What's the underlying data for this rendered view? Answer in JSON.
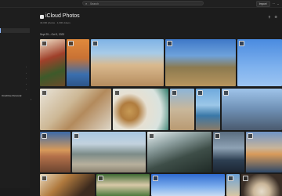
{
  "titlebar": {
    "search_placeholder": "Search",
    "import_label": "Import",
    "menu_label": "···"
  },
  "sidebar": {
    "items": [
      {
        "label": ""
      },
      {
        "label": ""
      },
      {
        "label": ""
      },
      {
        "label": ""
      },
      {
        "label": ""
      },
      {
        "label": ""
      },
      {
        "label": ""
      },
      {
        "label": "OneDrive Personal"
      }
    ]
  },
  "header": {
    "title": "iCloud Photos",
    "subtitle": "40,000 photos · 1,000 videos",
    "date_range": "Sept 25 – Oct 3, 2023"
  },
  "colors": {
    "background": "#1c1c1c",
    "sidebar_bg": "#1e1e1e",
    "selection_accent": "#8ab4f8"
  },
  "icons": [
    "search-icon",
    "cloud-icon",
    "filter-icon",
    "settings-icon",
    "chevron-left-icon",
    "checkbox-icon"
  ],
  "photos": [
    {
      "name": "photo-food-bowls"
    },
    {
      "name": "photo-orange-building"
    },
    {
      "name": "photo-desert-rock"
    },
    {
      "name": "photo-joshua-tree"
    },
    {
      "name": "photo-eiffel-sky"
    },
    {
      "name": "photo-dog-bed"
    },
    {
      "name": "photo-latte-croissant"
    },
    {
      "name": "photo-dog-beach"
    },
    {
      "name": "photo-beach-rocks"
    },
    {
      "name": "photo-eiffel-closeup"
    },
    {
      "name": "photo-coast-sunset"
    },
    {
      "name": "photo-city-mountains"
    },
    {
      "name": "photo-forest-sunbeams"
    },
    {
      "name": "photo-ocean-waves"
    },
    {
      "name": "photo-sunset-sea"
    },
    {
      "name": "photo-food-plates"
    },
    {
      "name": "photo-dog-grass"
    },
    {
      "name": "photo-blue-sky"
    },
    {
      "name": "photo-beach-people"
    },
    {
      "name": "photo-dessert-plate"
    }
  ]
}
